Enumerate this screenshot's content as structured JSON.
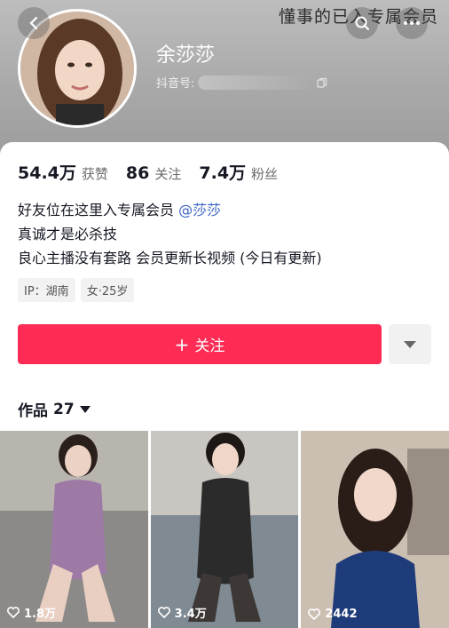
{
  "watermark": "懂事的已入专属会员",
  "profile": {
    "name": "余莎莎",
    "douyin_label": "抖音号:"
  },
  "stats": [
    {
      "value": "54.4万",
      "label": "获赞"
    },
    {
      "value": "86",
      "label": "关注"
    },
    {
      "value": "7.4万",
      "label": "粉丝"
    }
  ],
  "bio": {
    "line1_prefix": "好友位在这里入专属会员 ",
    "line1_mention": "@莎莎",
    "line2": "真诚才是必杀技",
    "line3": "良心主播没有套路  会员更新长视频 (今日有更新)"
  },
  "tags": [
    "IP：湖南",
    "女·25岁"
  ],
  "follow_button": {
    "plus": "+",
    "label": "关注"
  },
  "works": {
    "label": "作品",
    "count": "27"
  },
  "videos": [
    {
      "likes": "1.8万"
    },
    {
      "likes": "3.4万"
    },
    {
      "likes": "2442"
    }
  ],
  "colors": {
    "accent": "#fe2c55",
    "mention": "#3a64c4",
    "header_gray": "#a9a9a9"
  }
}
